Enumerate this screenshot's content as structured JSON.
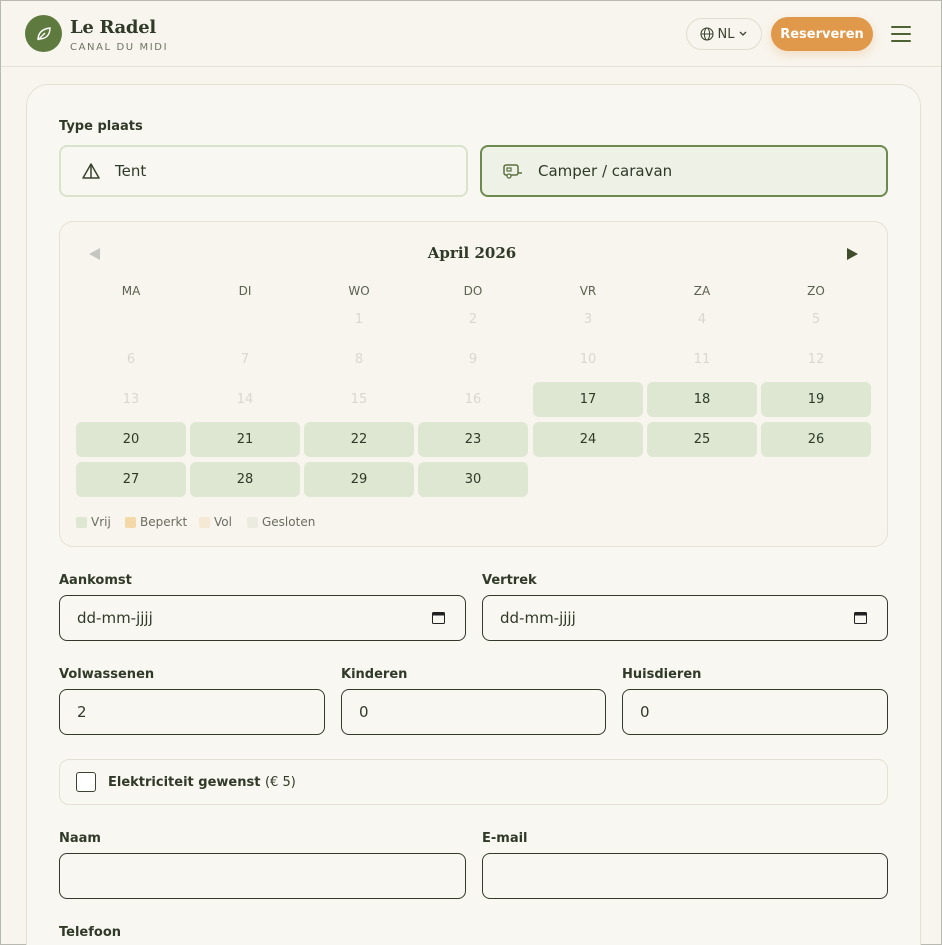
{
  "header": {
    "brand_name": "Le Radel",
    "brand_sub": "CANAL DU MIDI",
    "lang": "NL",
    "reserve_label": "Reserveren"
  },
  "colors": {
    "brand_green": "#5f7a3e",
    "accent_orange": "#e0984a",
    "free_day": "#dde7d1",
    "selected_border": "#6d8a4e"
  },
  "type": {
    "label": "Type plaats",
    "options": [
      {
        "label": "Tent",
        "icon": "tent-icon",
        "selected": false
      },
      {
        "label": "Camper / caravan",
        "icon": "caravan-icon",
        "selected": true
      }
    ]
  },
  "calendar": {
    "month": "April 2026",
    "weekdays": [
      "MA",
      "DI",
      "WO",
      "DO",
      "VR",
      "ZA",
      "ZO"
    ],
    "past_days": [
      "1",
      "2",
      "3",
      "4",
      "5",
      "6",
      "7",
      "8",
      "9",
      "10",
      "11",
      "12",
      "13",
      "14",
      "15",
      "16"
    ],
    "free_days": [
      "17",
      "18",
      "19",
      "20",
      "21",
      "22",
      "23",
      "24",
      "25",
      "26",
      "27",
      "28",
      "29",
      "30"
    ],
    "legend": [
      {
        "label": "Vrij",
        "color": "#dde7d1"
      },
      {
        "label": "Beperkt",
        "color": "#f3d9a8"
      },
      {
        "label": "Vol",
        "color": "#f5e9d6"
      },
      {
        "label": "Gesloten",
        "color": "#ecebdf"
      }
    ]
  },
  "form": {
    "arrival_label": "Aankomst",
    "arrival_value": "dd-mm-jjjj",
    "departure_label": "Vertrek",
    "departure_value": "dd-mm-jjjj",
    "adults_label": "Volwassenen",
    "adults_value": "2",
    "children_label": "Kinderen",
    "children_value": "0",
    "pets_label": "Huisdieren",
    "pets_value": "0",
    "electricity_label": "Elektriciteit gewenst",
    "electricity_price": "(€ 5)",
    "name_label": "Naam",
    "email_label": "E-mail",
    "phone_label": "Telefoon"
  }
}
